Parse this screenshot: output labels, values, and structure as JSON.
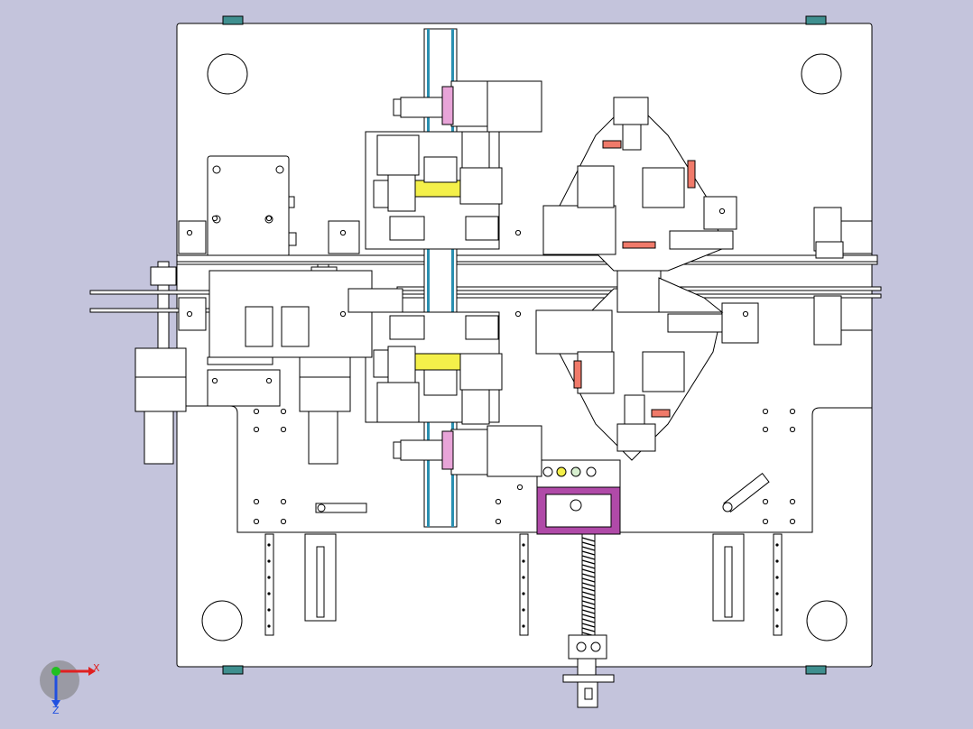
{
  "view": {
    "background": "#c4c4dc",
    "line_color": "#000000",
    "part_fill": "#ffffff",
    "plate_fill": "#ffffff"
  },
  "colors": {
    "highlight_yellow": "#f4f04a",
    "magenta": "#b04aa8",
    "pink_light": "#e8a4d8",
    "teal": "#3f8f8f",
    "salmon": "#f07a6a",
    "cyan_line": "#2a8fb0",
    "shadow_gray": "#9a9aa4"
  },
  "triad": {
    "x_label": "X",
    "z_label": "Z",
    "x_color": "#e02020",
    "y_color": "#20c020",
    "z_color": "#2050e0"
  }
}
